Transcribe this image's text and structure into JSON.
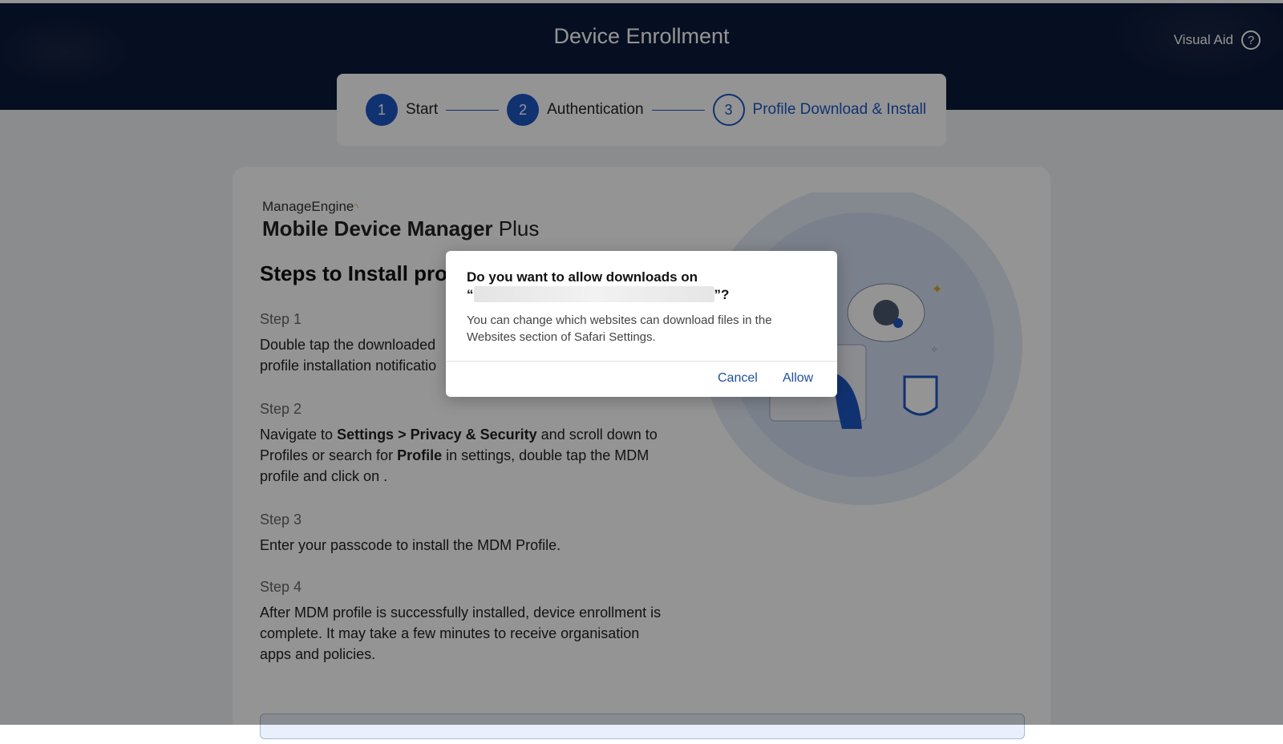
{
  "header": {
    "title": "Device Enrollment",
    "visual_aid_label": "Visual Aid",
    "help_glyph": "?"
  },
  "stepper": {
    "steps": [
      {
        "number": "1",
        "label": "Start",
        "state": "complete"
      },
      {
        "number": "2",
        "label": "Authentication",
        "state": "complete"
      },
      {
        "number": "3",
        "label": "Profile Download & Install",
        "state": "active"
      }
    ],
    "accent_color": "#1e56c3"
  },
  "brand": {
    "company": "ManageEngine",
    "product": "Mobile Device Manager",
    "product_suffix": "Plus"
  },
  "main": {
    "title": "Steps to Install profi",
    "steps": [
      {
        "heading": "Step 1",
        "text": "Double tap the downloaded profile installation notificatio"
      },
      {
        "heading": "Step 2",
        "text_parts": [
          "Navigate to ",
          "Settings > Privacy & Security",
          " and scroll down to Profiles or search for ",
          "Profile",
          " in settings, double tap the MDM profile and click on ."
        ]
      },
      {
        "heading": "Step 3",
        "text": "Enter your passcode to install the MDM Profile."
      },
      {
        "heading": "Step 4",
        "text": "After MDM profile is successfully installed, device enrollment is complete. It may take a few minutes to receive organisation apps and policies."
      }
    ]
  },
  "dialog": {
    "title_line1": "Do you want to allow downloads on",
    "title_open_quote": "“",
    "title_close": "”?",
    "message": "You can change which websites can download files in the Websites section of Safari Settings.",
    "cancel_label": "Cancel",
    "allow_label": "Allow",
    "button_color": "#1f4f9e"
  }
}
